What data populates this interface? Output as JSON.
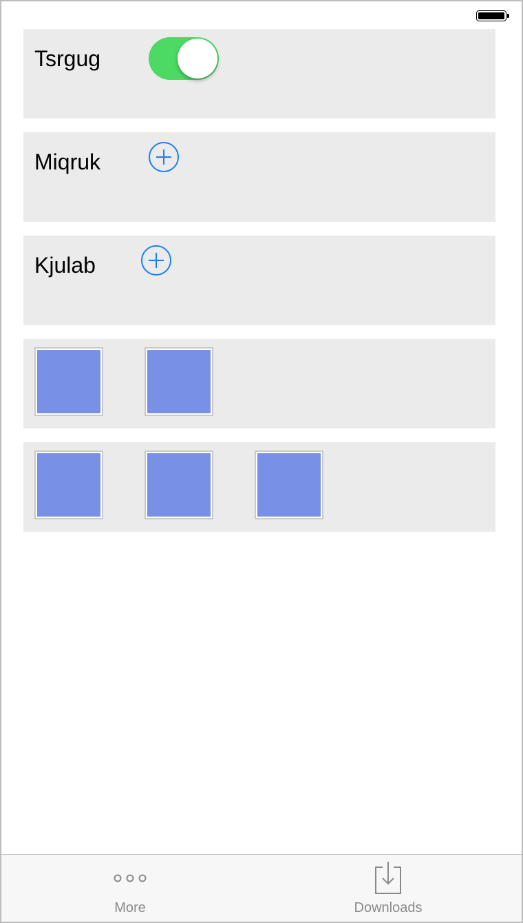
{
  "status_bar": {
    "battery_icon": "battery-full-icon"
  },
  "rows": [
    {
      "label": "Tsrgug",
      "control": "switch",
      "switch_on": true,
      "switch_color": "#4cd964"
    },
    {
      "label": "Miqruk",
      "control": "add-button",
      "icon": "plus-circle-icon"
    },
    {
      "label": "Kjulab",
      "control": "add-button",
      "icon": "plus-circle-icon"
    },
    {
      "thumbnails": 2
    },
    {
      "thumbnails": 3
    }
  ],
  "colors": {
    "accent_blue": "#1a7ff5",
    "thumbnail_fill": "#7890e6",
    "row_background": "#ebebeb"
  },
  "tabbar": {
    "tabs": [
      {
        "label": "More",
        "icon": "more-dots-icon"
      },
      {
        "label": "Downloads",
        "icon": "download-tray-icon"
      }
    ]
  }
}
